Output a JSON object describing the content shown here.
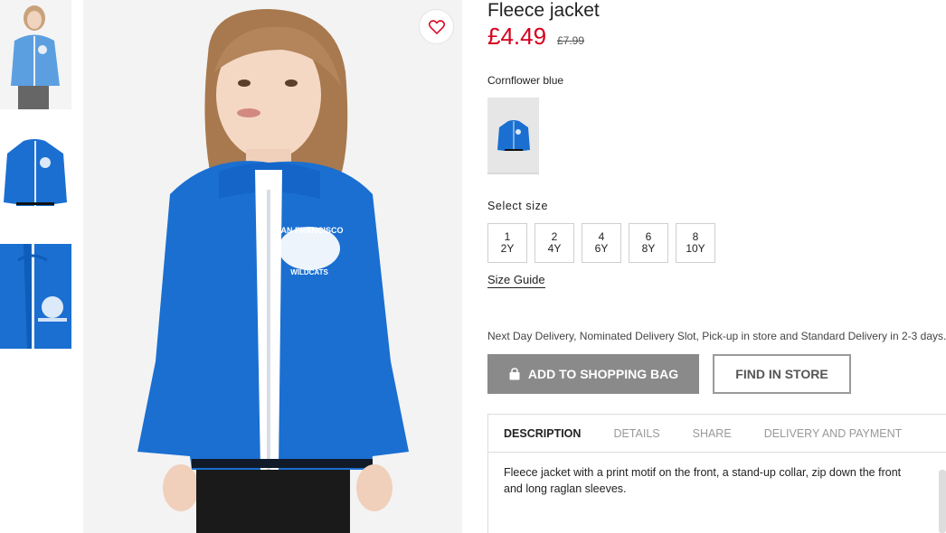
{
  "product": {
    "title": "Fleece jacket",
    "price": "£4.49",
    "old_price": "£7.99",
    "color_name": "Cornflower blue",
    "print_text_top": "SAN FRANCISCO",
    "print_text_bottom": "WILDCATS"
  },
  "sizes": {
    "label": "Select size",
    "options": [
      {
        "line1": "1",
        "line2": "2Y"
      },
      {
        "line1": "2",
        "line2": "4Y"
      },
      {
        "line1": "4",
        "line2": "6Y"
      },
      {
        "line1": "6",
        "line2": "8Y"
      },
      {
        "line1": "8",
        "line2": "10Y"
      }
    ],
    "guide": "Size Guide"
  },
  "delivery_text": "Next Day Delivery, Nominated Delivery Slot, Pick-up in store and Standard Delivery in 2-3 days.",
  "buttons": {
    "add_to_bag": "ADD TO SHOPPING BAG",
    "find_in_store": "FIND IN STORE"
  },
  "tabs": [
    {
      "label": "DESCRIPTION",
      "active": true
    },
    {
      "label": "DETAILS",
      "active": false
    },
    {
      "label": "SHARE",
      "active": false
    },
    {
      "label": "DELIVERY AND PAYMENT",
      "active": false
    }
  ],
  "description": "Fleece jacket with a print motif on the front, a stand-up collar, zip down the front and long raglan sleeves.",
  "colors": {
    "price_red": "#d6001c",
    "jacket_blue": "#1a6fd1",
    "button_grey": "#8a8a8a"
  },
  "icons": {
    "favourite": "heart-icon",
    "bag": "shopping-bag-icon"
  }
}
